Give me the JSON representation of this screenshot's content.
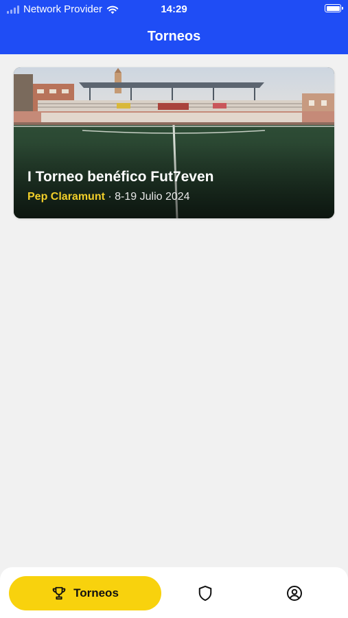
{
  "status_bar": {
    "carrier": "Network Provider",
    "time": "14:29"
  },
  "header": {
    "title": "Torneos"
  },
  "tournaments": [
    {
      "name": "I Torneo benéfico Fut7even",
      "organizer": "Pep Claramunt",
      "separator": " · ",
      "dates": "8-19 Julio 2024"
    }
  ],
  "bottom_nav": {
    "active_label": "Torneos",
    "items": [
      {
        "icon": "trophy-icon",
        "label": "Torneos",
        "active": true
      },
      {
        "icon": "shield-icon",
        "label": "",
        "active": false
      },
      {
        "icon": "user-circle-icon",
        "label": "",
        "active": false
      }
    ]
  },
  "colors": {
    "header_blue": "#1f4df5",
    "accent_yellow": "#f8d20d",
    "organizer_yellow": "#f2cf2a",
    "background": "#f1f1f1"
  }
}
